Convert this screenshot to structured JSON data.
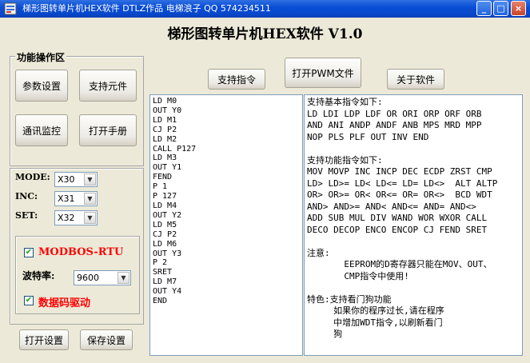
{
  "window": {
    "title": "梯形图转单片机HEX软件  DTLZ作品  电梯浪子 QQ 574234511",
    "controls": {
      "minimize": "_",
      "maximize": "□",
      "close": "×"
    }
  },
  "app_title": "梯形图转单片机HEX软件  V1.0",
  "func_group": {
    "label": "功能操作区",
    "buttons": [
      "参数设置",
      "支持元件",
      "通讯监控",
      "打开手册"
    ]
  },
  "params": {
    "mode": {
      "label": "MODE:",
      "value": "X30"
    },
    "inc": {
      "label": "INC:",
      "value": "X31"
    },
    "set": {
      "label": "SET:",
      "value": "X32"
    }
  },
  "modbus": {
    "checkbox_label": "MODBOS-RTU",
    "checked": true,
    "baud_label": "波特率:",
    "baud_value": "9600",
    "driver_label": "数据码驱动",
    "driver_checked": true
  },
  "bottom_buttons": {
    "open_settings": "打开设置",
    "save_settings": "保存设置"
  },
  "top_buttons": {
    "support": "支持指令",
    "open_pwm": "打开PWM文件",
    "about": "关于软件"
  },
  "program_text": "LD M0\nOUT Y0\nLD M1\nCJ P2\nLD M2\nCALL P127\nLD M3\nOUT Y1\nFEND\nP 1\nP 127\nLD M4\nOUT Y2\nLD M5\nCJ P2\nLD M6\nOUT Y3\nP 2\nSRET\nLD M7\nOUT Y4\nEND",
  "info_text": "支持基本指令如下:\nLD LDI LDP LDF OR ORI ORP ORF ORB\nAND ANI ANDP ANDF ANB MPS MRD MPP\nNOP PLS PLF OUT INV END\n\n支持功能指令如下:\nMOV MOVP INC INCP DEC ECDP ZRST CMP\nLD> LD>= LD< LD<= LD= LD<>  ALT ALTP\nOR> OR>= OR< OR<= OR= OR<>  BCD WDT\nAND> AND>= AND< AND<= AND= AND<>\nADD SUB MUL DIV WAND WOR WXOR CALL\nDECO DECOP ENCO ENCOP CJ FEND SRET\n\n注意:\n       EEPROM的D寄存器只能在MOV、OUT、\n       CMP指令中使用!\n\n特色:支持看门狗功能\n     如果你的程序过长,请在程序\n     中增加WDT指令,以刷新看门\n     狗"
}
